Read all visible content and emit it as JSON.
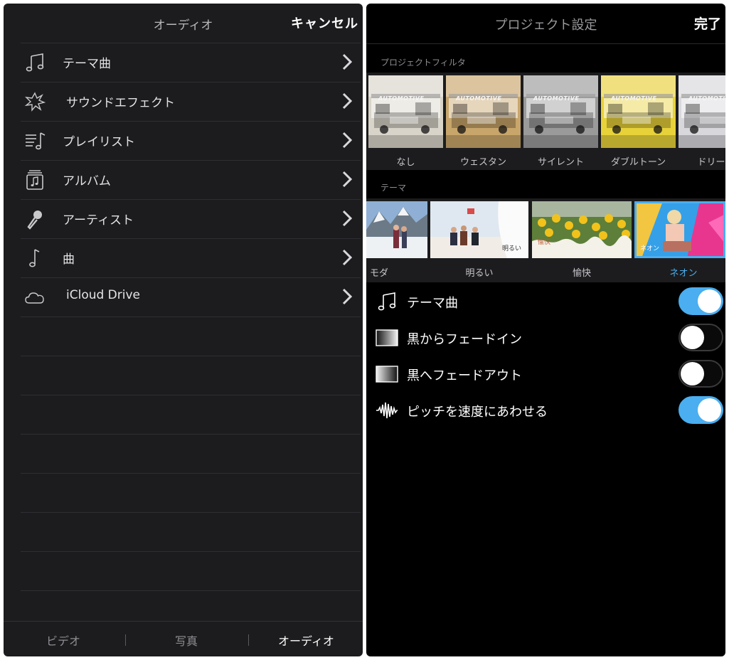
{
  "audio_panel": {
    "title": "オーディオ",
    "cancel_label": "キャンセル",
    "items": [
      {
        "label": "テーマ曲",
        "icon": "music-notes-icon"
      },
      {
        "label": "サウンドエフェクト",
        "icon": "burst-icon"
      },
      {
        "label": "プレイリスト",
        "icon": "playlist-icon"
      },
      {
        "label": "アルバム",
        "icon": "album-icon"
      },
      {
        "label": "アーティスト",
        "icon": "microphone-icon"
      },
      {
        "label": "曲",
        "icon": "music-note-icon"
      },
      {
        "label": "iCloud Drive",
        "icon": "cloud-icon"
      }
    ],
    "tabs": [
      {
        "label": "ビデオ",
        "active": false
      },
      {
        "label": "写真",
        "active": false
      },
      {
        "label": "オーディオ",
        "active": true
      }
    ]
  },
  "project_panel": {
    "title": "プロジェクト設定",
    "done_label": "完了",
    "filters_section_label": "プロジェクトフィルタ",
    "thumbnail_sign_text": "AUTOMOTIVE",
    "filters": [
      {
        "label": "なし",
        "tint": "#d9d4c9"
      },
      {
        "label": "ウェスタン",
        "tint": "#c8a56a"
      },
      {
        "label": "サイレント",
        "tint": "#9a9a9a"
      },
      {
        "label": "ダブルトーン",
        "tint": "#e8d23a"
      },
      {
        "label": "ドリーミ",
        "tint": "#d8d8dc"
      }
    ],
    "themes_section_label": "テーマ",
    "themes": [
      {
        "label": "モダン",
        "badge": "",
        "selected": false
      },
      {
        "label": "明るい",
        "badge": "明るい",
        "selected": false
      },
      {
        "label": "愉快",
        "badge": "愉快",
        "selected": false
      },
      {
        "label": "ネオン",
        "badge": "ネオン",
        "selected": true
      }
    ],
    "settings": [
      {
        "label": "テーマ曲",
        "icon": "music-notes-icon",
        "on": true
      },
      {
        "label": "黒からフェードイン",
        "icon": "fade-in-icon",
        "on": false
      },
      {
        "label": "黒へフェードアウト",
        "icon": "fade-out-icon",
        "on": false
      },
      {
        "label": "ピッチを速度にあわせる",
        "icon": "waveform-icon",
        "on": true
      }
    ],
    "accent_color": "#4aaef0"
  }
}
